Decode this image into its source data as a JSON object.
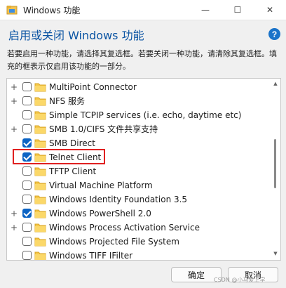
{
  "window": {
    "title": "Windows 功能",
    "controls": {
      "minimize": "—",
      "maximize": "☐",
      "close": "✕"
    }
  },
  "header": {
    "title": "启用或关闭 Windows 功能",
    "help": "?"
  },
  "description": "若要启用一种功能，请选择其复选框。若要关闭一种功能，请清除其复选框。填充的框表示仅启用该功能的一部分。",
  "features": [
    {
      "label": "MultiPoint Connector",
      "expander": "+",
      "checked": false
    },
    {
      "label": "NFS 服务",
      "expander": "+",
      "checked": false
    },
    {
      "label": "Simple TCPIP services (i.e. echo, daytime etc)",
      "expander": "",
      "checked": false
    },
    {
      "label": "SMB 1.0/CIFS 文件共享支持",
      "expander": "+",
      "checked": false
    },
    {
      "label": "SMB Direct",
      "expander": "",
      "checked": true
    },
    {
      "label": "Telnet Client",
      "expander": "",
      "checked": true
    },
    {
      "label": "TFTP Client",
      "expander": "",
      "checked": false
    },
    {
      "label": "Virtual Machine Platform",
      "expander": "",
      "checked": false
    },
    {
      "label": "Windows Identity Foundation 3.5",
      "expander": "",
      "checked": false
    },
    {
      "label": "Windows PowerShell 2.0",
      "expander": "+",
      "checked": true
    },
    {
      "label": "Windows Process Activation Service",
      "expander": "+",
      "checked": false
    },
    {
      "label": "Windows Projected File System",
      "expander": "",
      "checked": false
    },
    {
      "label": "Windows TIFF IFilter",
      "expander": "",
      "checked": false
    }
  ],
  "buttons": {
    "ok": "确定",
    "cancel": "取消"
  },
  "watermark": "CSDN @小马爱上学",
  "colors": {
    "accent": "#0b63c4",
    "header": "#0b54a3",
    "highlight": "#e02020"
  }
}
